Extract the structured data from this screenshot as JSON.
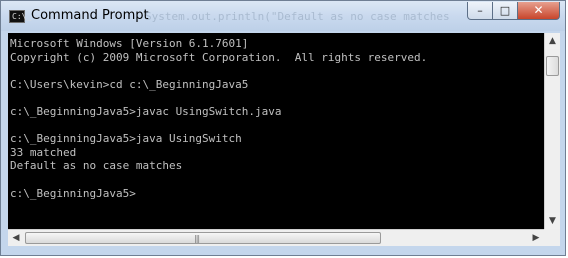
{
  "window": {
    "title": "Command Prompt",
    "app_icon_text": "C:\\_",
    "background_code_text": "System.out.println(\"Default as no case matches",
    "controls": {
      "minimize": "–",
      "maximize": "□",
      "close": "✕"
    }
  },
  "console": {
    "lines": [
      "Microsoft Windows [Version 6.1.7601]",
      "Copyright (c) 2009 Microsoft Corporation.  All rights reserved.",
      "",
      "C:\\Users\\kevin>cd c:\\_BeginningJava5",
      "",
      "c:\\_BeginningJava5>javac UsingSwitch.java",
      "",
      "c:\\_BeginningJava5>java UsingSwitch",
      "33 matched",
      "Default as no case matches",
      "",
      "c:\\_BeginningJava5>"
    ]
  },
  "scrollbars": {
    "up_arrow": "▲",
    "down_arrow": "▼",
    "left_arrow": "◀",
    "right_arrow": "▶",
    "grip": "|||"
  },
  "colors": {
    "console_bg": "#000000",
    "console_fg": "#c0c0c0",
    "frame": "#c4d6ec",
    "close_button": "#c8452b"
  }
}
